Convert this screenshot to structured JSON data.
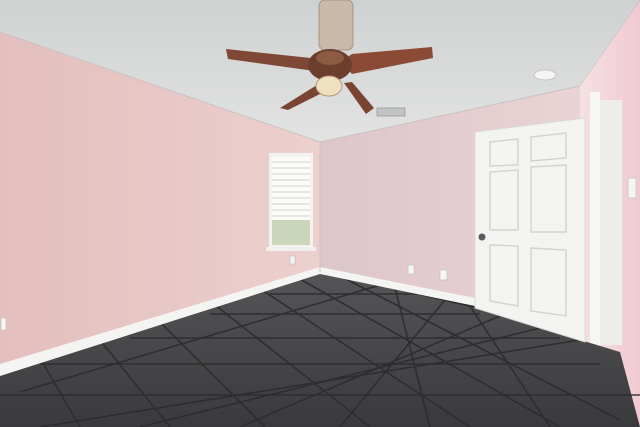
{
  "scene": {
    "kind": "empty-bedroom-interior",
    "colors": {
      "ceiling": "#d8dad9",
      "left_wall": "#e9c8c6",
      "back_wall": "#e6cdd0",
      "right_wall": "#f1d9da",
      "floor": "#4a4a4c",
      "grout": "#2f2f30",
      "baseboard": "#f4f4f2",
      "door": "#f3f3f1",
      "fan_blade": "#8a4a35",
      "fan_hub": "#6b3e2e"
    },
    "objects": [
      "ceiling-fan",
      "ceiling-vent",
      "smoke-detector",
      "window-with-blinds",
      "interior-door",
      "door-handle",
      "light-switch",
      "wall-outlets",
      "tile-floor",
      "baseboards"
    ]
  }
}
